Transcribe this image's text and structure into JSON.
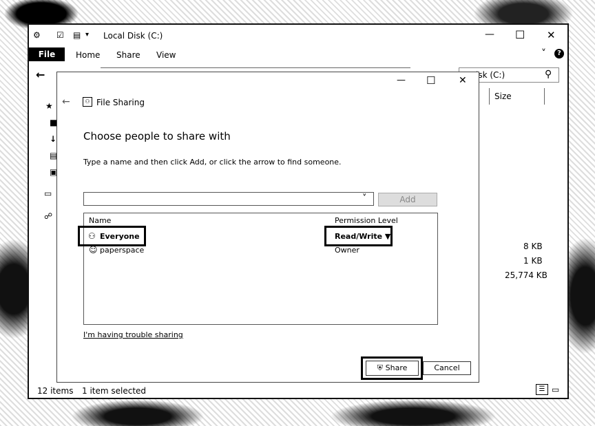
{
  "explorer": {
    "title": "Local Disk (C:)",
    "tabs": [
      "File",
      "Home",
      "Share",
      "View"
    ],
    "search_text": "isk (C:)",
    "column_size": "Size",
    "sizes": [
      "8 KB",
      "1 KB",
      "25,774 KB"
    ],
    "status_items": "12 items",
    "status_selected": "1 item selected"
  },
  "dialog": {
    "title": "File Sharing",
    "heading": "Choose people to share with",
    "instruction": "Type a name and then click Add, or click the arrow to find someone.",
    "add_label": "Add",
    "col_name": "Name",
    "col_permission": "Permission Level",
    "rows": [
      {
        "name": "Everyone",
        "permission": "Read/Write ▼"
      },
      {
        "name": "paperspace",
        "permission": "Owner"
      }
    ],
    "trouble_link": "I'm having trouble sharing",
    "share_label": "Share",
    "cancel_label": "Cancel"
  },
  "icons": {
    "minimize": "—",
    "maximize": "☐",
    "close": "✕",
    "back_arrow": "←",
    "search": "⚲",
    "help": "?",
    "chevron": "˅"
  }
}
